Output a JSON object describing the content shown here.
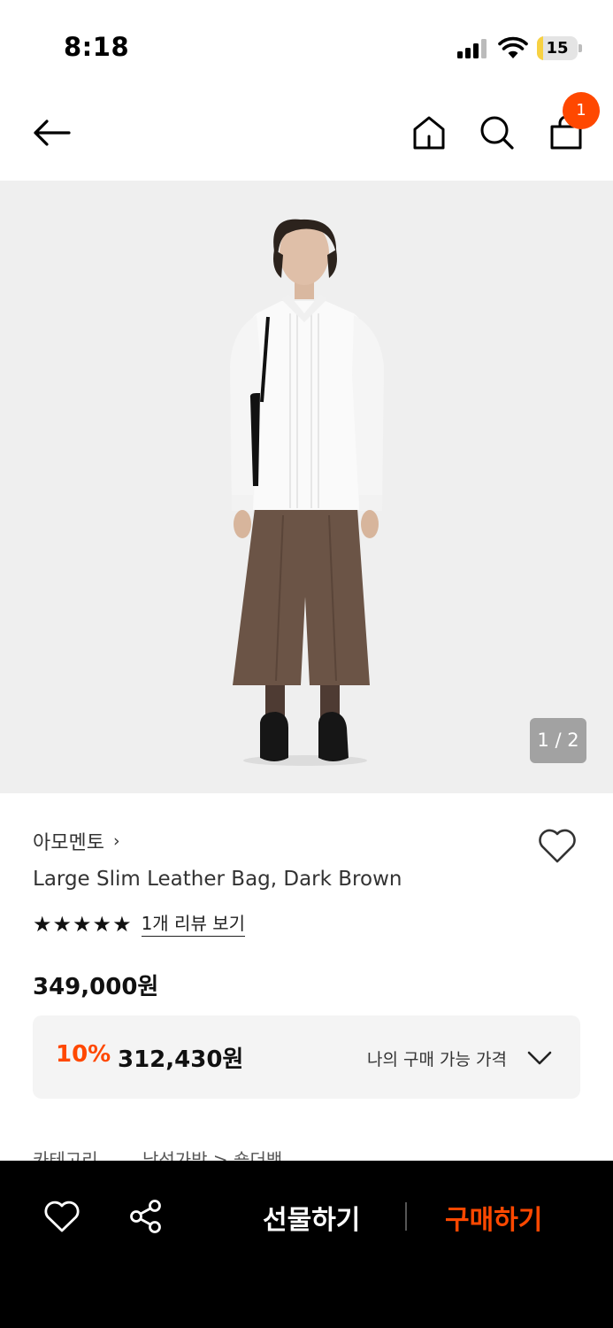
{
  "status_bar": {
    "time": "8:18",
    "battery_level": "15",
    "battery_fraction": 0.15,
    "battery_color": "#f7d142"
  },
  "header": {
    "back_icon": "arrow-left-icon",
    "home_icon": "home-icon",
    "search_icon": "search-icon",
    "cart_icon": "shopping-bag-icon",
    "cart_count": "1",
    "badge_color": "#ff4800"
  },
  "gallery": {
    "counter": "1 / 2",
    "current": 1,
    "total": 2
  },
  "product": {
    "brand": "아모멘토",
    "brand_chevron": "›",
    "title": "Large Slim Leather Bag, Dark Brown",
    "rating_stars": 5,
    "review_link": "1개 리뷰 보기",
    "price": "349,000원",
    "wishlist_icon": "heart-outline-icon"
  },
  "discount": {
    "rate": "10%",
    "price": "312,430원",
    "my_price_label": "나의 구매 가능 가격",
    "chevron_icon": "chevron-down-icon",
    "accent_color": "#ff4800"
  },
  "category": {
    "label": "카테고리",
    "path": "남성가방 > 숄더백"
  },
  "bottom_bar": {
    "like_icon": "heart-outline-icon",
    "share_icon": "share-icon",
    "gift_label": "선물하기",
    "buy_label": "구매하기",
    "buy_color": "#ff4800"
  }
}
